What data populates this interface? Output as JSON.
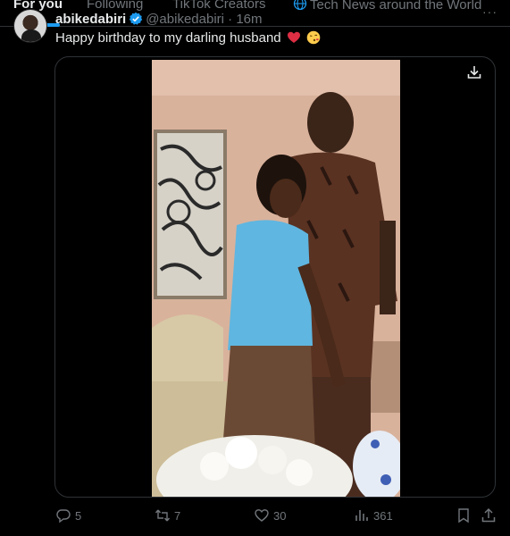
{
  "tabs": [
    {
      "label": "For you",
      "active": true
    },
    {
      "label": "Following",
      "active": false
    },
    {
      "label": "TikTok Creators",
      "active": false
    },
    {
      "label": "Tech News around the World",
      "active": false
    }
  ],
  "tweet": {
    "display_name": "abikedabiri",
    "handle": "@abikedabiri",
    "separator": "·",
    "time": "16m",
    "text": "Happy birthday to my darling husband"
  },
  "actions": {
    "replies": "5",
    "reposts": "7",
    "likes": "30",
    "views": "361"
  },
  "icons": [
    "globe-icon",
    "verified-icon",
    "heart-emoji",
    "kiss-emoji",
    "download-icon",
    "reply-icon",
    "repost-icon",
    "like-icon",
    "views-icon",
    "bookmark-icon",
    "share-icon",
    "more-icon"
  ],
  "colors": {
    "accent": "#1d9bf0",
    "heart": "#f91880",
    "muted": "#71767b",
    "text": "#e7e9ea"
  }
}
